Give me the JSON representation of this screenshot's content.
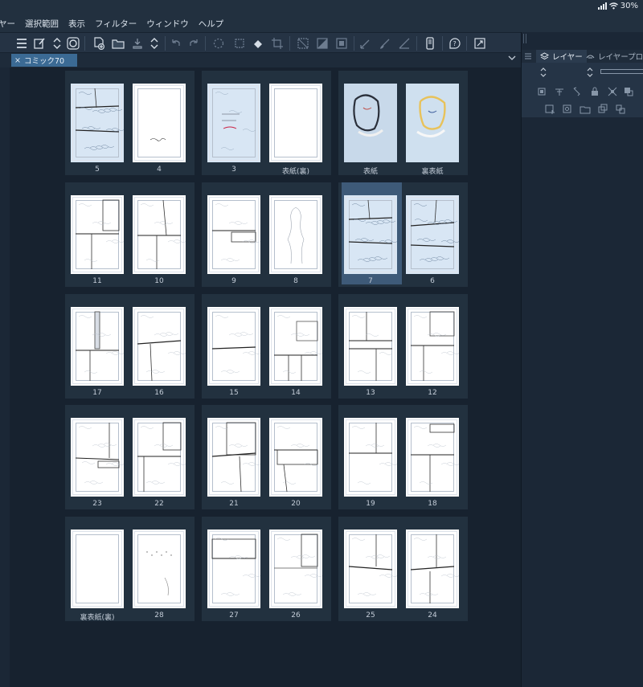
{
  "status": {
    "battery": "30%"
  },
  "menu": [
    "ヤー",
    "選択範囲",
    "表示",
    "フィルター",
    "ウィンドウ",
    "ヘルプ"
  ],
  "tab": {
    "close": "×",
    "title": "コミック70"
  },
  "panel": {
    "layer_tab": "レイヤー",
    "prop_tab": "レイヤープロ"
  },
  "spreads": [
    {
      "pages": [
        {
          "label": "5",
          "blue": true,
          "art": "panels-dense"
        },
        {
          "label": "4",
          "blue": false,
          "art": "blank-sign"
        }
      ]
    },
    {
      "pages": [
        {
          "label": "3",
          "blue": true,
          "art": "sketch-note"
        },
        {
          "label": "表紙(裏)",
          "blue": false,
          "art": "blank"
        }
      ]
    },
    {
      "pages": [
        {
          "label": "表紙",
          "blue": false,
          "art": "cover-left"
        },
        {
          "label": "裏表紙",
          "blue": false,
          "art": "cover-right"
        }
      ]
    },
    {
      "pages": [
        {
          "label": "11",
          "blue": false,
          "art": "panels-a"
        },
        {
          "label": "10",
          "blue": false,
          "art": "panels-b"
        }
      ]
    },
    {
      "pages": [
        {
          "label": "9",
          "blue": false,
          "art": "panels-c"
        },
        {
          "label": "8",
          "blue": false,
          "art": "figure"
        }
      ]
    },
    {
      "pages": [
        {
          "label": "7",
          "blue": true,
          "art": "panels-dense",
          "selected": true
        },
        {
          "label": "6",
          "blue": true,
          "art": "panels-dense2"
        }
      ]
    },
    {
      "pages": [
        {
          "label": "17",
          "blue": false,
          "art": "panels-d"
        },
        {
          "label": "16",
          "blue": false,
          "art": "panels-e"
        }
      ]
    },
    {
      "pages": [
        {
          "label": "15",
          "blue": false,
          "art": "panels-f"
        },
        {
          "label": "14",
          "blue": false,
          "art": "panels-g"
        }
      ]
    },
    {
      "pages": [
        {
          "label": "13",
          "blue": false,
          "art": "panels-h"
        },
        {
          "label": "12",
          "blue": false,
          "art": "panels-i"
        }
      ]
    },
    {
      "pages": [
        {
          "label": "23",
          "blue": false,
          "art": "panels-j"
        },
        {
          "label": "22",
          "blue": false,
          "art": "panels-k"
        }
      ]
    },
    {
      "pages": [
        {
          "label": "21",
          "blue": false,
          "art": "panels-l"
        },
        {
          "label": "20",
          "blue": false,
          "art": "panels-m"
        }
      ]
    },
    {
      "pages": [
        {
          "label": "19",
          "blue": false,
          "art": "panels-n"
        },
        {
          "label": "18",
          "blue": false,
          "art": "panels-o"
        }
      ]
    },
    {
      "pages": [
        {
          "label": "裏表紙(裏)",
          "blue": false,
          "art": "blank"
        },
        {
          "label": "28",
          "blue": false,
          "art": "dots"
        }
      ]
    },
    {
      "pages": [
        {
          "label": "27",
          "blue": false,
          "art": "panels-p"
        },
        {
          "label": "26",
          "blue": false,
          "art": "panels-q"
        }
      ]
    },
    {
      "pages": [
        {
          "label": "25",
          "blue": false,
          "art": "panels-r"
        },
        {
          "label": "24",
          "blue": false,
          "art": "panels-s"
        }
      ]
    }
  ],
  "colors": {
    "accent": "#3b6a94",
    "selected": "#3e5a78",
    "page_blue": "#d8e6f4"
  }
}
